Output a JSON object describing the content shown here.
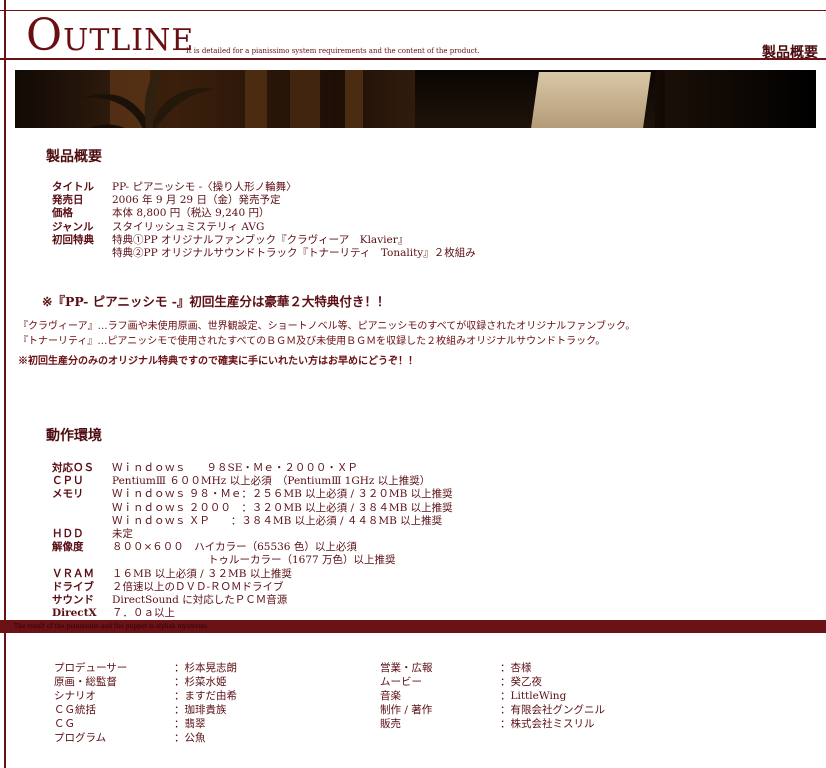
{
  "header": {
    "logo_first": "O",
    "logo_rest": "UTLINE",
    "tagline": "It is detailed for a pianissimo system requirements and the content of the product.",
    "right_title": "製品概要"
  },
  "product": {
    "section_title": "製品概要",
    "rows": [
      {
        "label": "タイトル",
        "value": "PP- ピアニッシモ -〈操り人形ノ輪舞〉"
      },
      {
        "label": "発売日",
        "value": "2006 年 9 月 29 日（金）発売予定"
      },
      {
        "label": "価格",
        "value": "本体 8,800 円（税込 9,240 円）"
      },
      {
        "label": "ジャンル",
        "value": "スタイリッシュミステリィ AVG"
      },
      {
        "label": "初回特典",
        "value": "特典①PP オリジナルファンブック『クラヴィーア　Klavier』"
      },
      {
        "label": "",
        "value": "特典②PP オリジナルサウンドトラック『トナーリティ　Tonality』２枚組み"
      }
    ]
  },
  "notice": "※『PP- ピアニッシモ -』初回生産分は豪華２大特典付き！！",
  "descriptions": [
    "『クラヴィーア』…ラフ画や未使用原画、世界観設定、ショートノベル等、ピアニッシモのすべてが収録されたオリジナルファンブック。",
    "『トナーリティ』…ピアニッシモで使用されたすべてのＢＧＭ及び未使用ＢＧＭを収録した２枚組みオリジナルサウンドトラック。",
    "※初回生産分のみのオリジナル特典ですので確実に手にいれたい方はお早めにどうぞ！！"
  ],
  "environment": {
    "section_title": "動作環境",
    "rows": [
      {
        "label": "対応ＯＳ",
        "value": "Ｗｉｎｄｏｗｓ　　９８SE・Ｍｅ・２０００・ＸＰ"
      },
      {
        "label": "ＣＰＵ",
        "value": "PentiumⅢ ６００MHz 以上必須　（PentiumⅢ 1GHz 以上推奨）"
      },
      {
        "label": "メモリ",
        "value": "Ｗｉｎｄｏｗｓ ９８・Ｍｅ：２５６MB 以上必須 / ３２０MB 以上推奨"
      },
      {
        "label": "",
        "value": "Ｗｉｎｄｏｗｓ ２０００　：３２０MB 以上必須 / ３８４MB 以上推奨"
      },
      {
        "label": "",
        "value": "Ｗｉｎｄｏｗｓ ＸＰ　　：３８４MB 以上必須 / ４４８MB 以上推奨"
      },
      {
        "label": "ＨＤＤ",
        "value": "未定"
      },
      {
        "label": "解像度",
        "value": "８００×６００　ハイカラー（65536 色）以上必須"
      },
      {
        "label": "",
        "value": "トゥルーカラー（1677 万色）以上推奨"
      },
      {
        "label": "ＶＲＡＭ",
        "value": "１６MB 以上必須 / ３２MB 以上推奨"
      },
      {
        "label": "ドライブ",
        "value": "２倍速以上のＤＶＤ-ＲＯＭドライブ"
      },
      {
        "label": "サウンド",
        "value": "DirectSound に対応したＰＣＭ音源"
      },
      {
        "label": "DirectX",
        "value": "７．０ａ以上"
      }
    ]
  },
  "footer_bar": "The result of the pianissimo and the puppet is stylish mysteries.",
  "credits_left": [
    {
      "role": "プロデューサー",
      "name": "：杉本晃志朗"
    },
    {
      "role": "原画・総監督",
      "name": "：杉菜水姫"
    },
    {
      "role": "シナリオ",
      "name": "：ますだ由希"
    },
    {
      "role": "ＣＧ統括",
      "name": "：珈琲貴族"
    },
    {
      "role": "ＣＧ",
      "name": "：翡翠"
    },
    {
      "role": "プログラム",
      "name": "：公魚"
    }
  ],
  "credits_right": [
    {
      "role": "営業・広報",
      "name": "：杏様"
    },
    {
      "role": "ムービー",
      "name": "：癸乙夜"
    },
    {
      "role": "音楽",
      "name": "：LittleWing"
    },
    {
      "role": "制作 / 著作",
      "name": "：有限会社グングニル"
    },
    {
      "role": "販売",
      "name": "：株式会社ミスリル"
    }
  ]
}
